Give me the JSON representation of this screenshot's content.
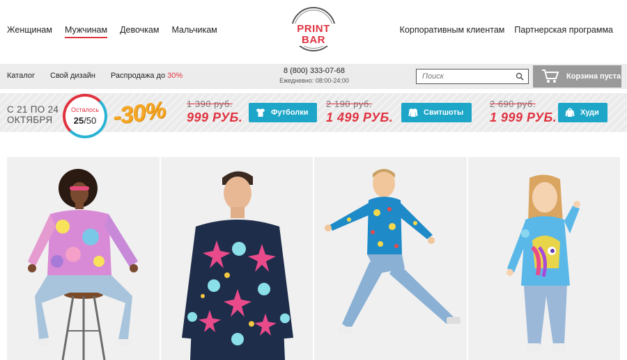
{
  "header": {
    "gender_nav": [
      "Женщинам",
      "Мужчинам",
      "Девочкам",
      "Мальчикам"
    ],
    "active_gender": 1,
    "logo_text": "PRINT BAR",
    "right_nav": [
      "Корпоративным клиентам",
      "Партнерская программа"
    ]
  },
  "subbar": {
    "catalog": "Каталог",
    "design": "Свой дизайн",
    "sale_prefix": "Распродажа до",
    "sale_value": "30%",
    "phone": "8 (800) 333-07-68",
    "hours": "Ежедневно: 08:00-24:00",
    "search_placeholder": "Поиск",
    "cart_label": "Корзина пуста"
  },
  "promo": {
    "dates_line1": "С 21 ПО 24",
    "dates_line2": "ОКТЯБРЯ",
    "remaining_label": "Осталось",
    "remaining_count": "25",
    "remaining_total": "/50",
    "remaining_fraction": 0.5,
    "discount": "-30%",
    "offers": [
      {
        "old": "1 390 руб.",
        "new": "999 РУБ.",
        "button": "Футболки",
        "icon": "tshirt-icon"
      },
      {
        "old": "2 190 руб.",
        "new": "1 499 РУБ.",
        "button": "Свитшоты",
        "icon": "sweatshirt-icon"
      },
      {
        "old": "2 690 руб.",
        "new": "1 999 РУБ.",
        "button": "Худи",
        "icon": "hoodie-icon"
      }
    ]
  },
  "colors": {
    "accent_red": "#e03340",
    "accent_blue": "#1ea6c8",
    "discount_orange": "#f5a623",
    "cart_gray": "#9a9a9a"
  },
  "products": [
    {
      "subject": "woman-on-stool-camo-sweatshirt"
    },
    {
      "subject": "man-skull-print-sweatshirt"
    },
    {
      "subject": "boy-jumping-blue-print-shirt"
    },
    {
      "subject": "girl-pony-print-shirt"
    }
  ]
}
